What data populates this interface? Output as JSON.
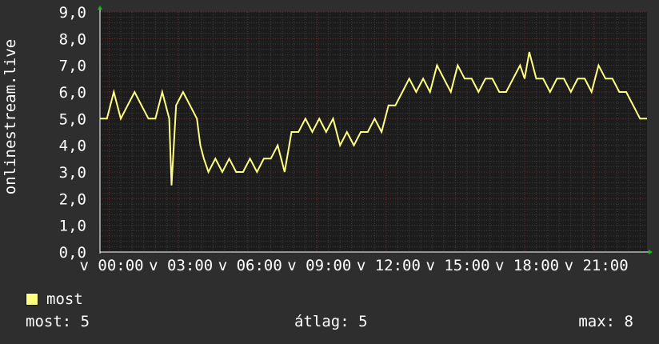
{
  "chart_data": {
    "type": "line",
    "ylabel": "onlinestream.live",
    "y_tick_labels": [
      "0,0",
      "1,0",
      "2,0",
      "3,0",
      "4,0",
      "5,0",
      "6,0",
      "7,0",
      "8,0",
      "9,0"
    ],
    "ylim": [
      0,
      9
    ],
    "xlim": [
      -0.4,
      23.3
    ],
    "x_tick_labels": [
      "v 00:00",
      "v 03:00",
      "v 06:00",
      "v 09:00",
      "v 12:00",
      "v 15:00",
      "v 18:00",
      "v 21:00"
    ],
    "x_tick_hours": [
      0,
      3,
      6,
      9,
      12,
      15,
      18,
      21
    ],
    "grid": true,
    "legend_position": "bottom-left",
    "series": [
      {
        "name": "most",
        "color": "#ffff80",
        "x": [
          -0.4,
          -0.1,
          0.2,
          0.5,
          0.8,
          1.1,
          1.4,
          1.7,
          2.0,
          2.3,
          2.6,
          2.7,
          2.9,
          3.2,
          3.5,
          3.8,
          3.95,
          4.1,
          4.3,
          4.6,
          4.9,
          5.2,
          5.5,
          5.8,
          6.1,
          6.4,
          6.7,
          7.0,
          7.3,
          7.6,
          7.9,
          8.2,
          8.5,
          8.8,
          9.1,
          9.4,
          9.7,
          10.0,
          10.3,
          10.6,
          10.9,
          11.2,
          11.5,
          11.8,
          12.1,
          12.4,
          12.7,
          13.0,
          13.3,
          13.6,
          13.9,
          14.2,
          14.5,
          14.8,
          15.1,
          15.4,
          15.7,
          16.0,
          16.3,
          16.6,
          16.9,
          17.2,
          17.5,
          17.8,
          18.0,
          18.2,
          18.5,
          18.8,
          19.1,
          19.4,
          19.7,
          20.0,
          20.3,
          20.6,
          20.9,
          21.2,
          21.5,
          21.8,
          22.1,
          22.4,
          22.7,
          23.0,
          23.3
        ],
        "values": [
          5,
          5,
          6,
          5,
          5.5,
          6,
          5.5,
          5,
          5,
          6,
          5,
          2.5,
          5.5,
          6,
          5.5,
          5,
          4,
          3.5,
          3,
          3.5,
          3,
          3.5,
          3,
          3,
          3.5,
          3,
          3.5,
          3.5,
          4,
          3,
          4.5,
          4.5,
          5,
          4.5,
          5,
          4.5,
          5,
          4,
          4.5,
          4,
          4.5,
          4.5,
          5,
          4.5,
          5.5,
          5.5,
          6,
          6.5,
          6,
          6.5,
          6,
          7,
          6.5,
          6,
          7,
          6.5,
          6.5,
          6,
          6.5,
          6.5,
          6,
          6,
          6.5,
          7,
          6.5,
          7.5,
          6.5,
          6.5,
          6,
          6.5,
          6.5,
          6,
          6.5,
          6.5,
          6,
          7,
          6.5,
          6.5,
          6,
          6,
          5.5,
          5,
          5
        ]
      }
    ]
  },
  "legend": {
    "label": "most",
    "color": "#ffff80"
  },
  "stats": {
    "current": "most: 5",
    "average": "átlag: 5",
    "max": "max: 8"
  }
}
